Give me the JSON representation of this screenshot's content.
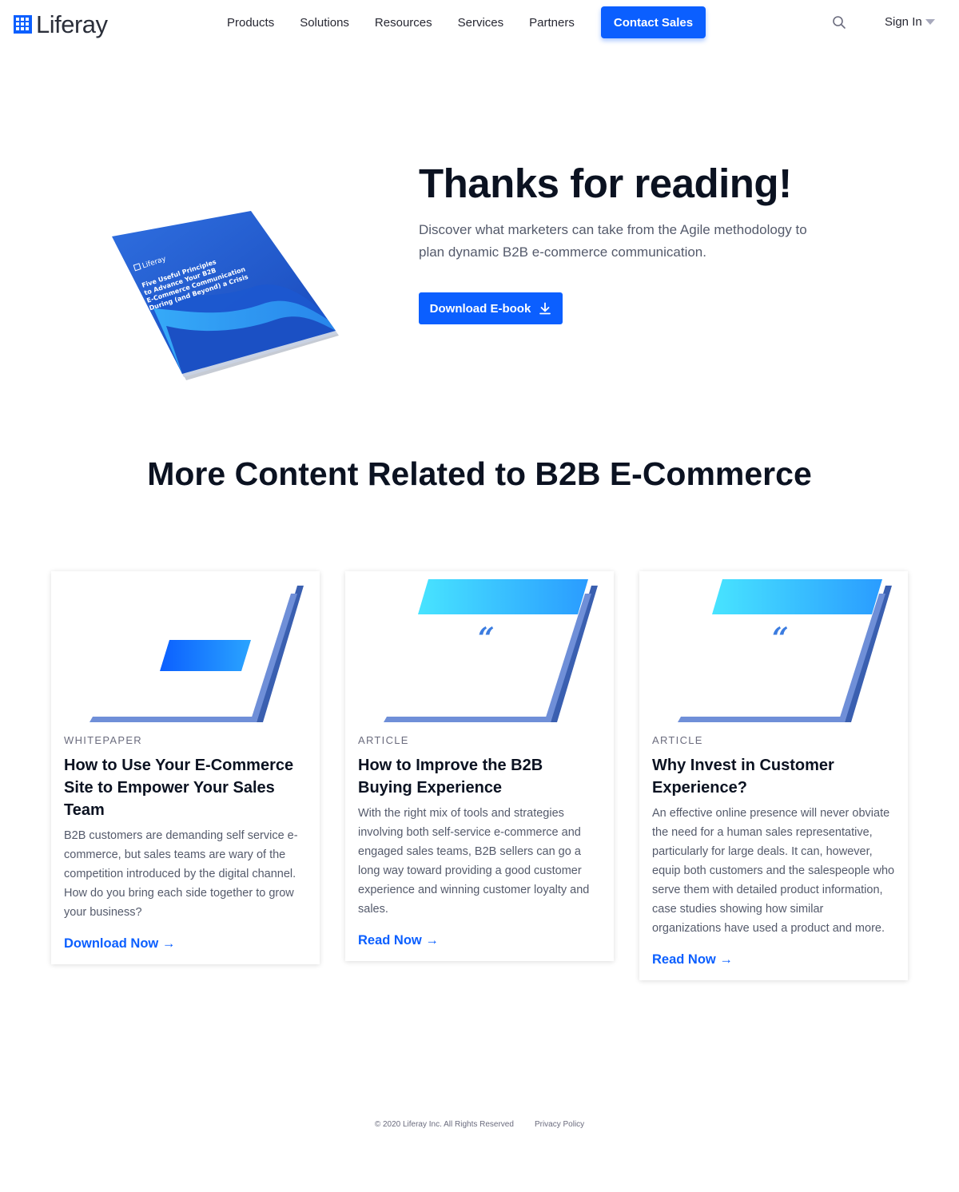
{
  "nav": {
    "logo_text": "Liferay",
    "links": [
      "Products",
      "Solutions",
      "Resources",
      "Services",
      "Partners"
    ],
    "contact_label": "Contact Sales",
    "signin_label": "Sign In"
  },
  "hero": {
    "title": "Thanks for reading!",
    "description": "Discover what marketers can take from the Agile methodology to plan dynamic B2B e-commerce communication.",
    "button_label": "Download E-book",
    "ebook_cover": {
      "brand": "Liferay",
      "title_lines": [
        "Five Useful Principles",
        "to Advance Your B2B",
        "E-Commerce Communication",
        "During (and Beyond) a Crisis"
      ]
    }
  },
  "related": {
    "title": "More Content Related to B2B E-Commerce",
    "cards": [
      {
        "type": "WHITEPAPER",
        "title": "How to Use Your E-Commerce Site to Empower Your Sales Team",
        "description": "B2B customers are demanding self service e-commerce, but sales teams are wary of the competition introduced by the digital channel.  How do you bring each side together to grow your business?",
        "link": "Download Now →"
      },
      {
        "type": "ARTICLE",
        "title": "How to Improve the B2B Buying Experience",
        "description": "With the right mix of tools and strategies involving both self-service e-commerce and engaged sales teams, B2B sellers can go a long way toward providing a good customer experience and winning customer loyalty and sales.",
        "link": "Read Now →"
      },
      {
        "type": "ARTICLE",
        "title": "Why Invest in Customer Experience?",
        "description": "An effective online presence will never obviate the need for a human sales representative, particularly for large deals. It can, however, equip both customers and the salespeople who serve them with detailed product information, case studies showing how similar organizations have used a product and more.",
        "link": "Read Now →"
      }
    ]
  },
  "footer": {
    "copyright": "© 2020 Liferay Inc. All Rights Reserved",
    "privacy": "Privacy Policy"
  },
  "colors": {
    "brand_blue": "#0b5fff",
    "heading": "#0b1221",
    "body_text": "#545a6b"
  },
  "icons": [
    "search-icon",
    "chevron-down-icon",
    "download-icon",
    "arrow-right-icon",
    "quote-icon"
  ]
}
